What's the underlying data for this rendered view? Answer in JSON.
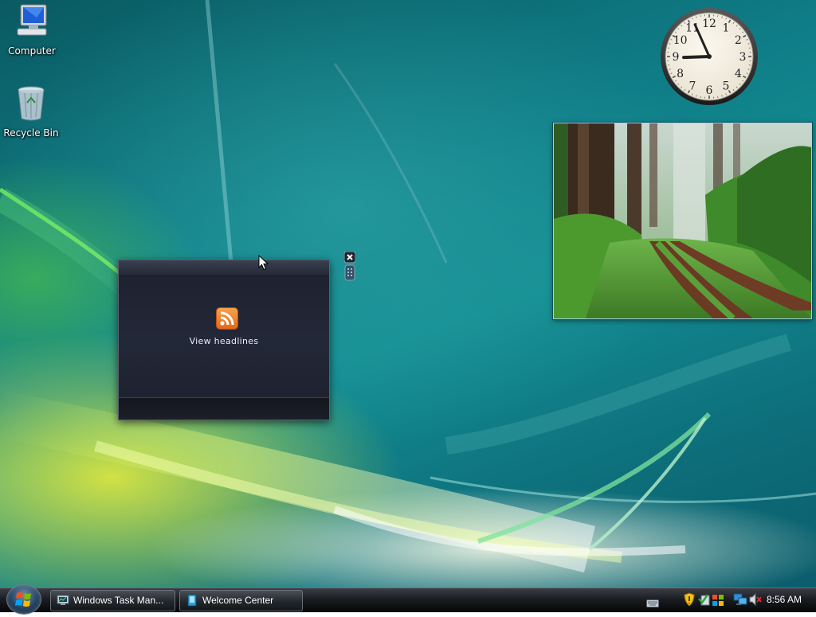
{
  "desktop": {
    "icons": [
      {
        "label": "Computer",
        "icon": "computer-icon"
      },
      {
        "label": "Recycle Bin",
        "icon": "recycle-bin-icon"
      }
    ]
  },
  "clock_gadget": {
    "numerals": [
      "12",
      "1",
      "2",
      "3",
      "4",
      "5",
      "6",
      "7",
      "8",
      "9",
      "10",
      "11"
    ],
    "time_shown": "8:56"
  },
  "slideshow_gadget": {
    "subject": "forest path photo"
  },
  "feed_gadget": {
    "icon": "rss-feed-icon",
    "link_label": "View headlines",
    "accent": "#f28b2c"
  },
  "taskbar": {
    "start": "start-button",
    "buttons": [
      {
        "label": "Windows Task Man...",
        "icon": "task-manager-icon"
      },
      {
        "label": "Welcome Center",
        "icon": "welcome-center-icon"
      }
    ],
    "tray": [
      "keyboard-icon",
      "security-shield-icon",
      "checkmark-icon",
      "windows-update-icon",
      "network-icon",
      "volume-muted-icon"
    ],
    "clock": "8:56 AM"
  }
}
